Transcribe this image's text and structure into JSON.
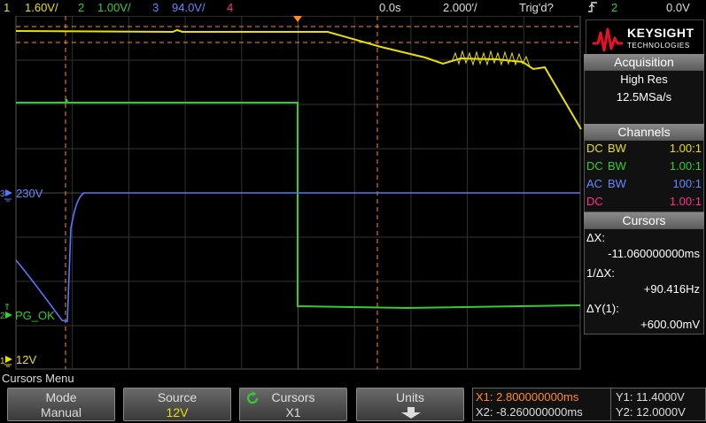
{
  "topbar": {
    "ch1_num": "1",
    "ch1_scale": "1.60V/",
    "ch2_num": "2",
    "ch2_scale": "1.00V/",
    "ch3_num": "3",
    "ch3_scale": "94.0V/",
    "ch4_num": "4",
    "time_delay": "0.0s",
    "time_scale": "2.000′/",
    "trigger_status": "Trig'd?",
    "trigger_slope_icon": "rising-edge-icon",
    "trigger_source": "2",
    "trigger_level": "0.0V"
  },
  "colors": {
    "ch1": "#e8e000",
    "ch2": "#33cc33",
    "ch3": "#5577ff",
    "ch4": "#ff2277",
    "cursor": "#ff8c1a",
    "grid": "#3a3a3a",
    "panel_header": "#6e6e6e"
  },
  "channel_labels": {
    "ch3_marker": "3",
    "ch3_level": "230V",
    "ch2_marker": "2",
    "ch2_level": "PG_OK",
    "ch1_marker": "1",
    "ch1_level": "12V"
  },
  "panel": {
    "brand": "KEYSIGHT",
    "brand_sub": "TECHNOLOGIES",
    "acquisition": {
      "title": "Acquisition",
      "mode": "High Res",
      "rate": "12.5MSa/s"
    },
    "channels": {
      "title": "Channels",
      "rows": [
        {
          "coupling": "DC",
          "bw": "BW",
          "probe": "1.00:1"
        },
        {
          "coupling": "DC",
          "bw": "BW",
          "probe": "1.00:1"
        },
        {
          "coupling": "AC",
          "bw": "BW",
          "probe": "100:1"
        },
        {
          "coupling": "DC",
          "bw": "",
          "probe": "1.00:1"
        }
      ]
    },
    "cursors": {
      "title": "Cursors",
      "dx_label": "ΔX:",
      "dx_value": "-11.060000000ms",
      "inv_dx_label": "1/ΔX:",
      "inv_dx_value": "+90.416Hz",
      "dy_label": "ΔY(1):",
      "dy_value": "+600.00mV"
    }
  },
  "menu": {
    "label": "Cursors Menu",
    "softkeys": [
      {
        "title": "Mode",
        "value": "Manual"
      },
      {
        "title": "Source",
        "value": "12V"
      },
      {
        "title": "Cursors",
        "value": "X1"
      },
      {
        "title": "Units",
        "value": ""
      }
    ],
    "readout": {
      "x1": "X1: 2.800000000ms",
      "x2": "X2: -8.260000000ms",
      "y1": "Y1: 11.4000V",
      "y2": "Y2: 12.0000V"
    }
  }
}
